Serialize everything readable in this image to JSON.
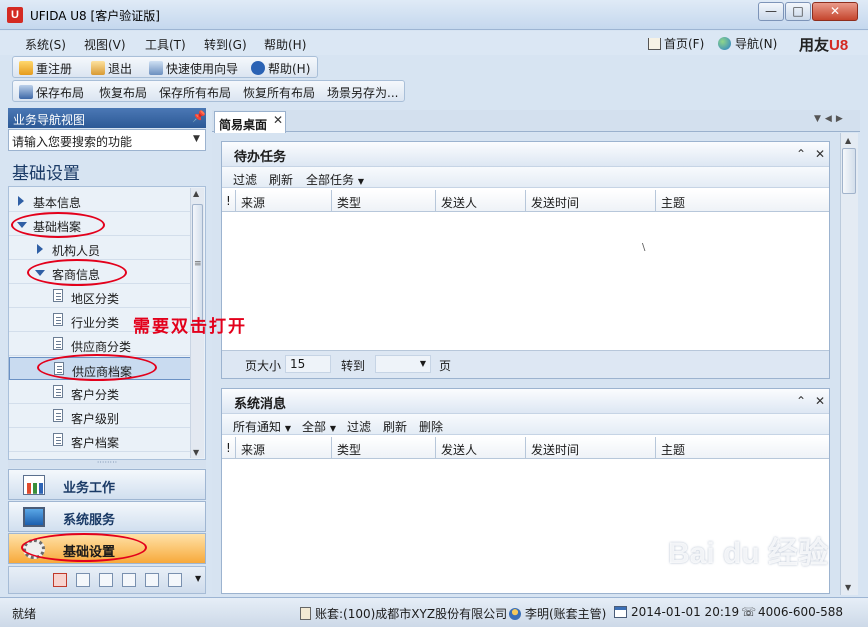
{
  "window": {
    "title": "UFIDA U8 [客户验证版]",
    "logo_text": "U",
    "min": "—",
    "max": "□",
    "close": "✕"
  },
  "menu": {
    "items": [
      "系统(S)",
      "视图(V)",
      "工具(T)",
      "转到(G)",
      "帮助(H)"
    ],
    "home": "首页(F)",
    "navigate": "导航(N)",
    "brand": "用友",
    "brand_suffix": "U8"
  },
  "toolbar1": {
    "relogin": "重注册",
    "exit": "退出",
    "wizard": "快速使用向导",
    "help": "帮助(H)"
  },
  "toolbar2": {
    "save_layout": "保存布局",
    "restore_layout": "恢复布局",
    "save_all": "保存所有布局",
    "restore_all": "恢复所有布局",
    "save_scene": "场景另存为..."
  },
  "nav": {
    "header": "业务导航视图",
    "search_placeholder": "请输入您要搜索的功能",
    "section_title": "基础设置",
    "tree": [
      "基本信息",
      "基础档案",
      "机构人员",
      "客商信息",
      "地区分类",
      "行业分类",
      "供应商分类",
      "供应商档案",
      "客户分类",
      "客户级别",
      "客户档案"
    ],
    "big_buttons": [
      "业务工作",
      "系统服务",
      "基础设置"
    ]
  },
  "tabs": {
    "desktop": "简易桌面"
  },
  "tasks_panel": {
    "title": "待办任务",
    "toolbar": [
      "过滤",
      "刷新",
      "全部任务"
    ],
    "columns": [
      "!",
      "来源",
      "类型",
      "发送人",
      "发送时间",
      "主题"
    ],
    "pager": {
      "page_size_label": "页大小",
      "page_size": "15",
      "goto_label": "转到",
      "page_label": "页"
    }
  },
  "messages_panel": {
    "title": "系统消息",
    "toolbar": [
      "所有通知",
      "全部",
      "过滤",
      "刷新",
      "删除"
    ],
    "columns": [
      "!",
      "来源",
      "类型",
      "发送人",
      "发送时间",
      "主题"
    ]
  },
  "status": {
    "ready": "就绪",
    "account": "账套:(100)成都市XYZ股份有限公司",
    "user": "李明(账套主管)",
    "datetime": "2014-01-01 20:19",
    "phone": "4006-600-588"
  },
  "annotation": "需要双击打开",
  "watermark": {
    "text": "Bai du 经验",
    "url": "jingyan.baidu.com"
  },
  "colors": {
    "annotation_red": "#e3001b",
    "nav_header_blue": "#2c5996",
    "active_orange": "#f7a93b"
  }
}
